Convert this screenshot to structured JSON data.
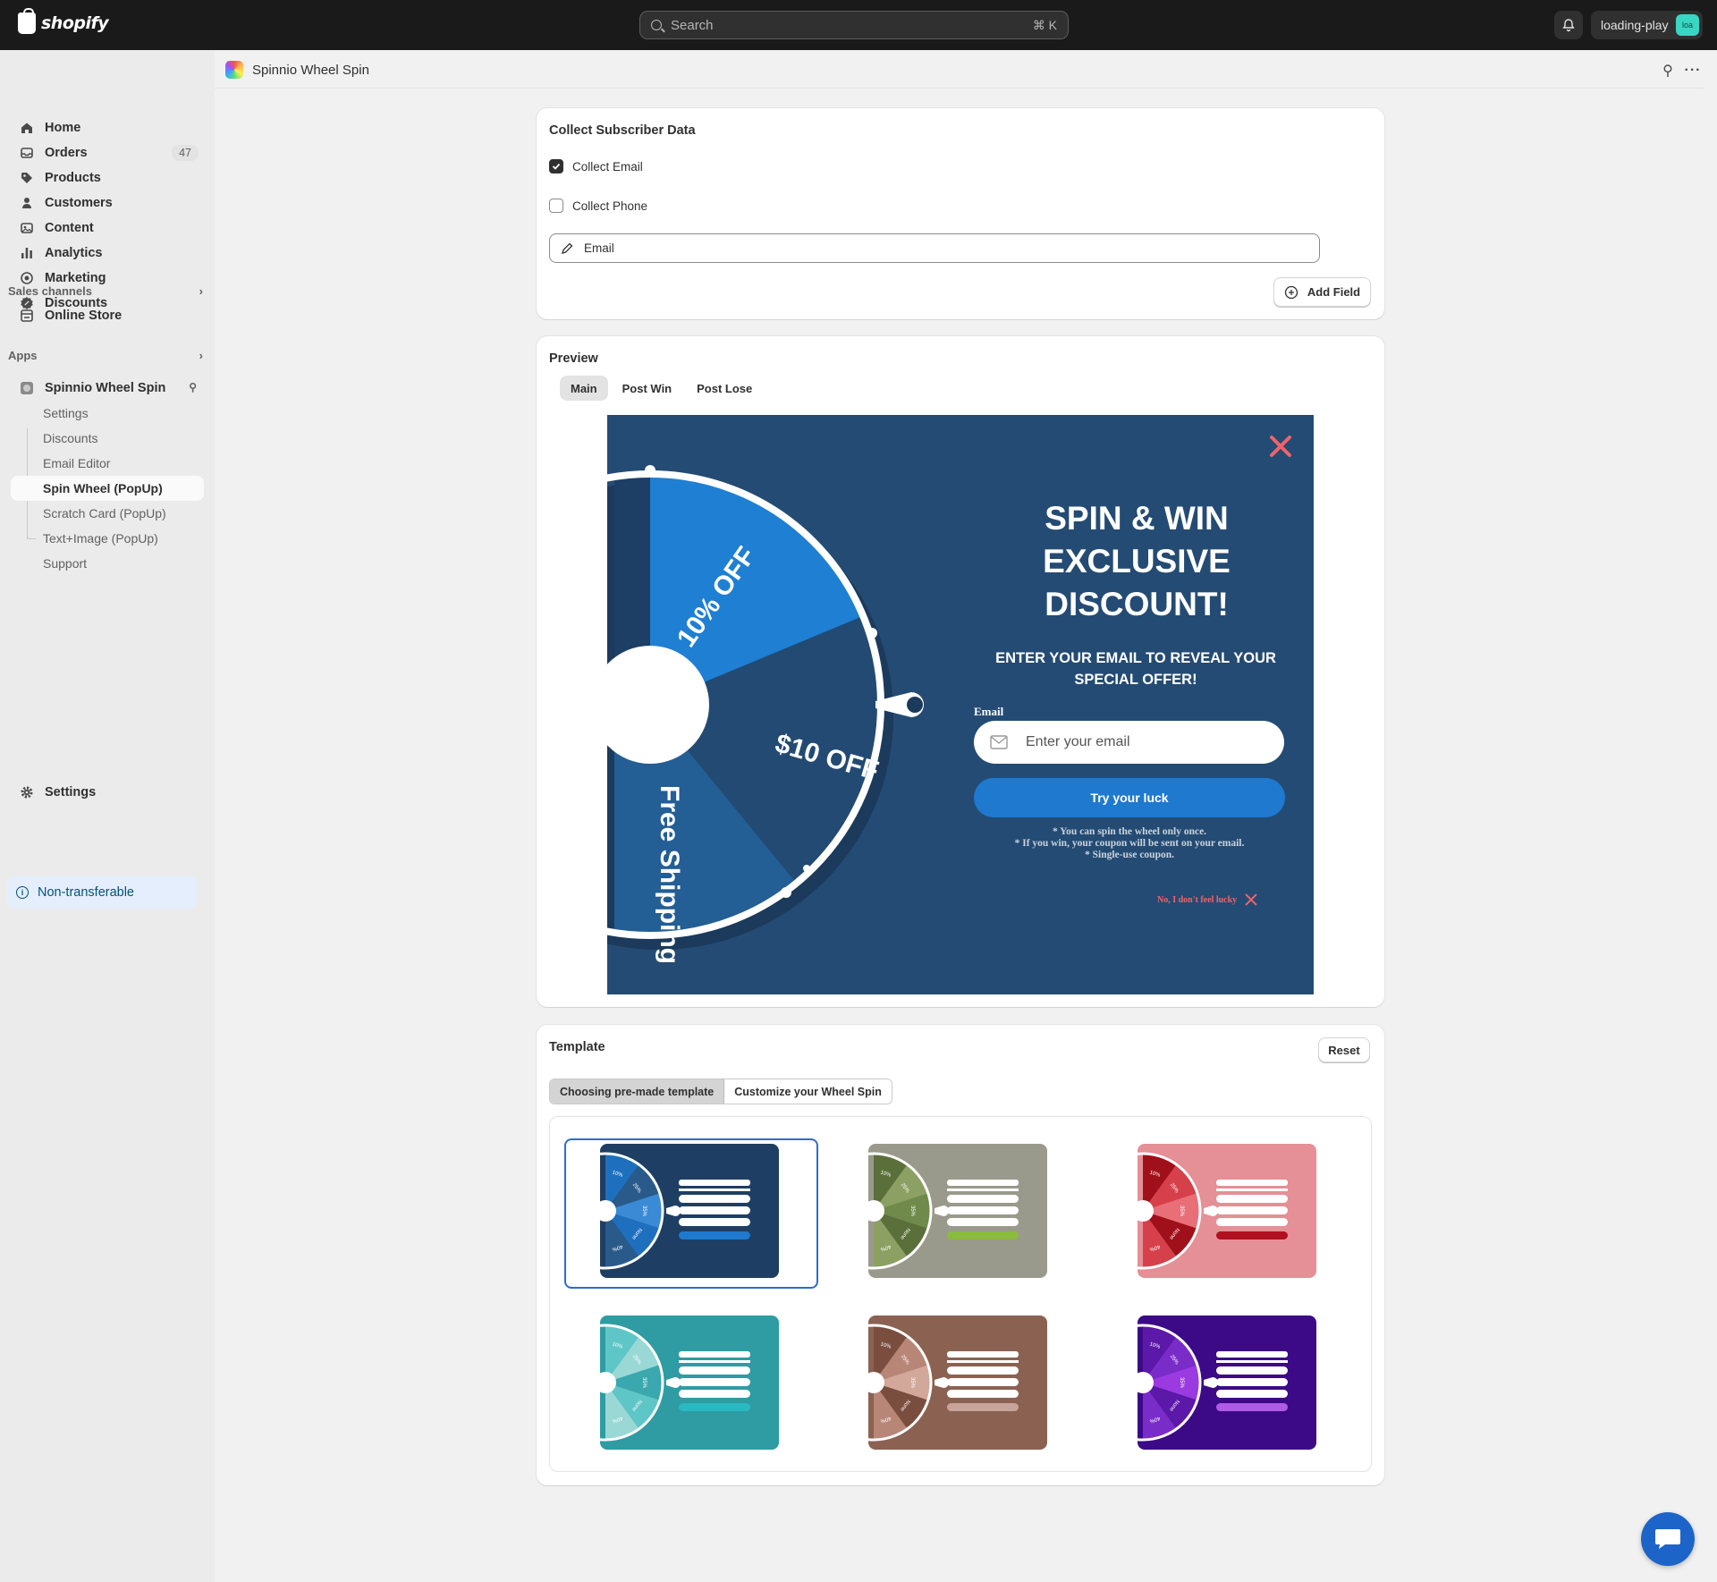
{
  "topbar": {
    "brand": "shopify",
    "search_placeholder": "Search",
    "search_shortcut": "⌘ K",
    "store_name": "loading-play",
    "avatar_initials": "loa"
  },
  "sidebar": {
    "main_items": [
      {
        "label": "Home",
        "icon": "home-icon"
      },
      {
        "label": "Orders",
        "icon": "orders-icon",
        "badge": "47"
      },
      {
        "label": "Products",
        "icon": "tag-icon"
      },
      {
        "label": "Customers",
        "icon": "person-icon"
      },
      {
        "label": "Content",
        "icon": "content-icon"
      },
      {
        "label": "Analytics",
        "icon": "bar-chart-icon"
      },
      {
        "label": "Marketing",
        "icon": "target-icon"
      },
      {
        "label": "Discounts",
        "icon": "discount-icon"
      }
    ],
    "sales_channels_label": "Sales channels",
    "online_store_label": "Online Store",
    "apps_label": "Apps",
    "app_name": "Spinnio Wheel Spin",
    "app_subitems": [
      "Settings",
      "Discounts",
      "Email Editor",
      "Spin Wheel (PopUp)",
      "Scratch Card (PopUp)",
      "Text+Image (PopUp)",
      "Support"
    ],
    "active_subitem": "Spin Wheel (PopUp)",
    "settings_label": "Settings",
    "non_transferable_label": "Non-transferable"
  },
  "page": {
    "app_title": "Spinnio Wheel Spin"
  },
  "collect": {
    "title": "Collect Subscriber Data",
    "collect_email_label": "Collect Email",
    "collect_email_checked": true,
    "collect_phone_label": "Collect Phone",
    "collect_phone_checked": false,
    "field_email_label": "Email",
    "add_field_label": "Add Field"
  },
  "preview": {
    "title": "Preview",
    "tabs": [
      "Main",
      "Post Win",
      "Post Lose"
    ],
    "active_tab": "Main",
    "wheel_segments": [
      "10% OFF",
      "$10 OFF",
      "Free Shipping"
    ],
    "headline": "SPIN & WIN EXCLUSIVE DISCOUNT!",
    "subheadline": "ENTER YOUR EMAIL TO REVEAL YOUR SPECIAL OFFER!",
    "email_label": "Email",
    "email_placeholder": "Enter your email",
    "cta_label": "Try your luck",
    "notes": [
      "* You can spin the wheel only once.",
      "* If you win, your coupon will be sent on your email.",
      "* Single-use coupon."
    ],
    "no_lucky_label": "No, I don't feel lucky",
    "colors": {
      "background": "#244b73",
      "button": "#1e79cf",
      "close": "#f0636a"
    }
  },
  "template": {
    "title": "Template",
    "reset_label": "Reset",
    "mode_tabs": [
      "Choosing pre-made template",
      "Customize your Wheel Spin"
    ],
    "active_mode": "Choosing pre-made template",
    "selected_index": 0,
    "templates": [
      {
        "bg": "#1e3f63",
        "accent": "#1e79cf",
        "wheel": [
          "#1f6fbf",
          "#2a5a8a",
          "#3a8ad6"
        ]
      },
      {
        "bg": "#9a9a8c",
        "accent": "#8bbb3c",
        "wheel": [
          "#5b6f3a",
          "#8ca063",
          "#6f8a4a"
        ]
      },
      {
        "bg": "#e58f96",
        "accent": "#b0101f",
        "wheel": [
          "#a0101b",
          "#d6404b",
          "#e86f78"
        ]
      },
      {
        "bg": "#2e9ca2",
        "accent": "#2ab8c2",
        "wheel": [
          "#5fc6c8",
          "#9ad8d6",
          "#3aa8ae"
        ]
      },
      {
        "bg": "#8b6252",
        "accent": "#c8a49a",
        "wheel": [
          "#7a4e3e",
          "#b88676",
          "#d2a89a"
        ]
      },
      {
        "bg": "#3c0a86",
        "accent": "#b05be6",
        "wheel": [
          "#5c18a8",
          "#7a2cc8",
          "#9a3ae0"
        ]
      }
    ],
    "wheel_labels": [
      "10%",
      "25%",
      "35%",
      "None",
      "40%"
    ]
  }
}
